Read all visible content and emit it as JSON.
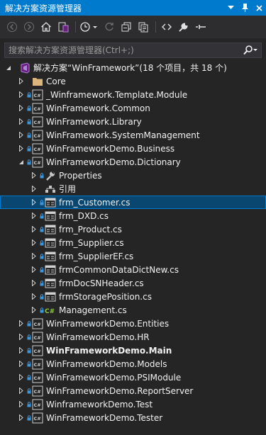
{
  "window": {
    "title": "解决方案资源管理器",
    "accent": "#007acc",
    "background": "#252526"
  },
  "search": {
    "placeholder": "搜索解决方案资源管理器(Ctrl+;)"
  },
  "tree": [
    {
      "depth": 0,
      "arrow": "expanded",
      "lock": false,
      "icon": "solution-icon",
      "label": "解决方案“WinFramework”(18 个项目，共 18 个)",
      "bold": false
    },
    {
      "depth": 1,
      "arrow": "collapsed",
      "lock": false,
      "icon": "folder-icon",
      "label": "Core",
      "bold": false
    },
    {
      "depth": 1,
      "arrow": "collapsed",
      "lock": true,
      "icon": "csharp-project-icon",
      "label": "_Winframework.Template.Module",
      "bold": false
    },
    {
      "depth": 1,
      "arrow": "collapsed",
      "lock": true,
      "icon": "csharp-project-icon",
      "label": "WinFramework.Common",
      "bold": false
    },
    {
      "depth": 1,
      "arrow": "collapsed",
      "lock": true,
      "icon": "csharp-project-icon",
      "label": "WinFramework.Library",
      "bold": false
    },
    {
      "depth": 1,
      "arrow": "collapsed",
      "lock": true,
      "icon": "csharp-project-icon",
      "label": "WinFramework.SystemManagement",
      "bold": false
    },
    {
      "depth": 1,
      "arrow": "collapsed",
      "lock": true,
      "icon": "csharp-project-icon",
      "label": "WinFrameworkDemo.Business",
      "bold": false
    },
    {
      "depth": 1,
      "arrow": "expanded",
      "lock": true,
      "icon": "csharp-project-icon",
      "label": "WinFrameworkDemo.Dictionary",
      "bold": false
    },
    {
      "depth": 2,
      "arrow": "collapsed",
      "lock": true,
      "icon": "wrench-icon",
      "label": "Properties",
      "bold": false
    },
    {
      "depth": 2,
      "arrow": "collapsed",
      "lock": false,
      "icon": "references-icon",
      "label": "引用",
      "bold": false
    },
    {
      "depth": 2,
      "arrow": "collapsed",
      "lock": true,
      "icon": "form-icon",
      "label": "frm_Customer.cs",
      "bold": false,
      "selected": true
    },
    {
      "depth": 2,
      "arrow": "collapsed",
      "lock": true,
      "icon": "form-icon",
      "label": "frm_DXD.cs",
      "bold": false
    },
    {
      "depth": 2,
      "arrow": "collapsed",
      "lock": true,
      "icon": "form-icon",
      "label": "frm_Product.cs",
      "bold": false
    },
    {
      "depth": 2,
      "arrow": "collapsed",
      "lock": true,
      "icon": "form-icon",
      "label": "frm_Supplier.cs",
      "bold": false
    },
    {
      "depth": 2,
      "arrow": "collapsed",
      "lock": true,
      "icon": "form-icon",
      "label": "frm_SupplierEF.cs",
      "bold": false
    },
    {
      "depth": 2,
      "arrow": "collapsed",
      "lock": true,
      "icon": "form-icon",
      "label": "frmCommonDataDictNew.cs",
      "bold": false
    },
    {
      "depth": 2,
      "arrow": "collapsed",
      "lock": true,
      "icon": "form-icon",
      "label": "frmDocSNHeader.cs",
      "bold": false
    },
    {
      "depth": 2,
      "arrow": "collapsed",
      "lock": true,
      "icon": "form-icon",
      "label": "frmStoragePosition.cs",
      "bold": false
    },
    {
      "depth": 2,
      "arrow": "collapsed",
      "lock": true,
      "icon": "csharp-file-icon",
      "label": "Management.cs",
      "bold": false
    },
    {
      "depth": 1,
      "arrow": "collapsed",
      "lock": true,
      "icon": "csharp-project-icon",
      "label": "WinFrameworkDemo.Entities",
      "bold": false
    },
    {
      "depth": 1,
      "arrow": "collapsed",
      "lock": true,
      "icon": "csharp-project-icon",
      "label": "WinFrameworkDemo.HR",
      "bold": false
    },
    {
      "depth": 1,
      "arrow": "collapsed",
      "lock": true,
      "icon": "csharp-project-icon",
      "label": "WinFrameworkDemo.Main",
      "bold": true
    },
    {
      "depth": 1,
      "arrow": "collapsed",
      "lock": true,
      "icon": "csharp-project-icon",
      "label": "WinFrameworkDemo.Models",
      "bold": false
    },
    {
      "depth": 1,
      "arrow": "collapsed",
      "lock": true,
      "icon": "csharp-project-icon",
      "label": "WinFrameworkDemo.PSIModule",
      "bold": false
    },
    {
      "depth": 1,
      "arrow": "collapsed",
      "lock": true,
      "icon": "csharp-project-icon",
      "label": "WinFrameworkDemo.ReportServer",
      "bold": false
    },
    {
      "depth": 1,
      "arrow": "collapsed",
      "lock": true,
      "icon": "csharp-project-icon",
      "label": "WinframeworkDemo.Test",
      "bold": false
    },
    {
      "depth": 1,
      "arrow": "collapsed",
      "lock": true,
      "icon": "csharp-project-icon",
      "label": "WinFrameworkDemo.Tester",
      "bold": false
    }
  ]
}
